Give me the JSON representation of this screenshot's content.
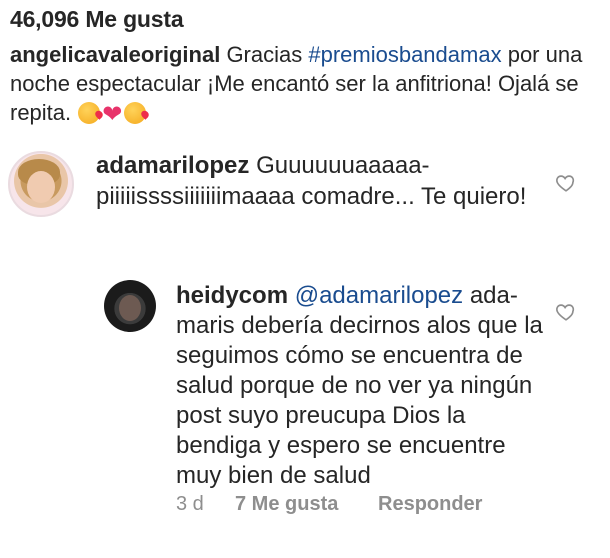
{
  "post": {
    "likes_text": "46,096 Me gusta",
    "caption": {
      "username": "angelicavaleoriginal",
      "text_before": "Gracias ",
      "hashtag": "#premiosbandamax",
      "text_after": " por una noche espectacular ¡Me encantó ser la anfitriona! Ojalá se repita. ",
      "emojis": [
        "kissing-face",
        "red-heart",
        "kissing-face"
      ]
    }
  },
  "comments": [
    {
      "username": "adamarilopez",
      "text": "Guuuuuuaaaaa-piiiiissssiiiiiiimaaaa comadre... Te quiero!",
      "avatar_icon": "woman-blonde-avatar"
    },
    {
      "username": "heidycom",
      "mention": "@adamarilopez",
      "text": " ada-maris debería decirnos alos que la seguimos cómo se encuentra de salud porque de no ver ya ningún post suyo preucupa Dios la bendiga y espero se encuentre muy bien de salud",
      "avatar_icon": "woman-dark-avatar",
      "time": "3 d",
      "likes": "7 Me gusta",
      "reply": "Responder"
    }
  ],
  "colors": {
    "text": "#262626",
    "link": "#1a4c8f",
    "muted": "#8e8e8e"
  }
}
